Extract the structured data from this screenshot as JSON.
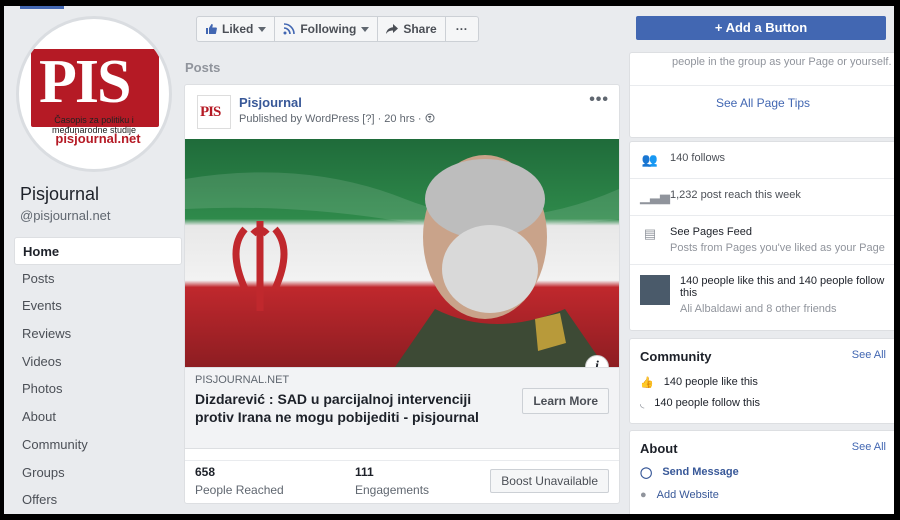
{
  "left": {
    "logo": {
      "letters": "PIS",
      "journal": "Časopis za politiku i međunarodne studije",
      "site": "pisjournal.net"
    },
    "page_name": "Pisjournal",
    "handle": "@pisjournal.net",
    "nav": [
      "Home",
      "Posts",
      "Events",
      "Reviews",
      "Videos",
      "Photos",
      "About",
      "Community",
      "Groups",
      "Offers"
    ]
  },
  "actionbar": {
    "liked": "Liked",
    "following": "Following",
    "share": "Share",
    "more": "···"
  },
  "center": {
    "section_label": "Posts",
    "post": {
      "author": "Pisjournal",
      "meta": "Published by WordPress [?] · 20 hrs ·",
      "logo_mini": "PIS",
      "link_domain": "PISJOURNAL.NET",
      "link_title": "Dizdarević : SAD u parcijalnoj intervenciji protiv Irana ne mogu pobijediti - pisjournal",
      "learn_more": "Learn More",
      "reached_num": "658",
      "reached_label": "People Reached",
      "eng_num": "111",
      "eng_label": "Engagements",
      "boost": "Boost Unavailable"
    }
  },
  "right": {
    "add_button": "Add a Button",
    "tips_text": "people in the group as your Page or yourself.",
    "tips_link": "See All Page Tips",
    "follows": "140 follows",
    "reach": "1,232 post reach this week",
    "feed_title": "See Pages Feed",
    "feed_sub": "Posts from Pages you've liked as your Page",
    "likes_follow": "140 people like this and 140 people follow this",
    "friends": "Ali Albaldawi and 8 other friends",
    "community_title": "Community",
    "see_all": "See All",
    "community_likes": "140 people like this",
    "community_follows": "140 people follow this",
    "about_title": "About",
    "send_message": "Send Message",
    "add_website": "Add Website"
  },
  "colors": {
    "brand": "#4267b2",
    "link": "#385898",
    "logo_red": "#b51a25"
  }
}
